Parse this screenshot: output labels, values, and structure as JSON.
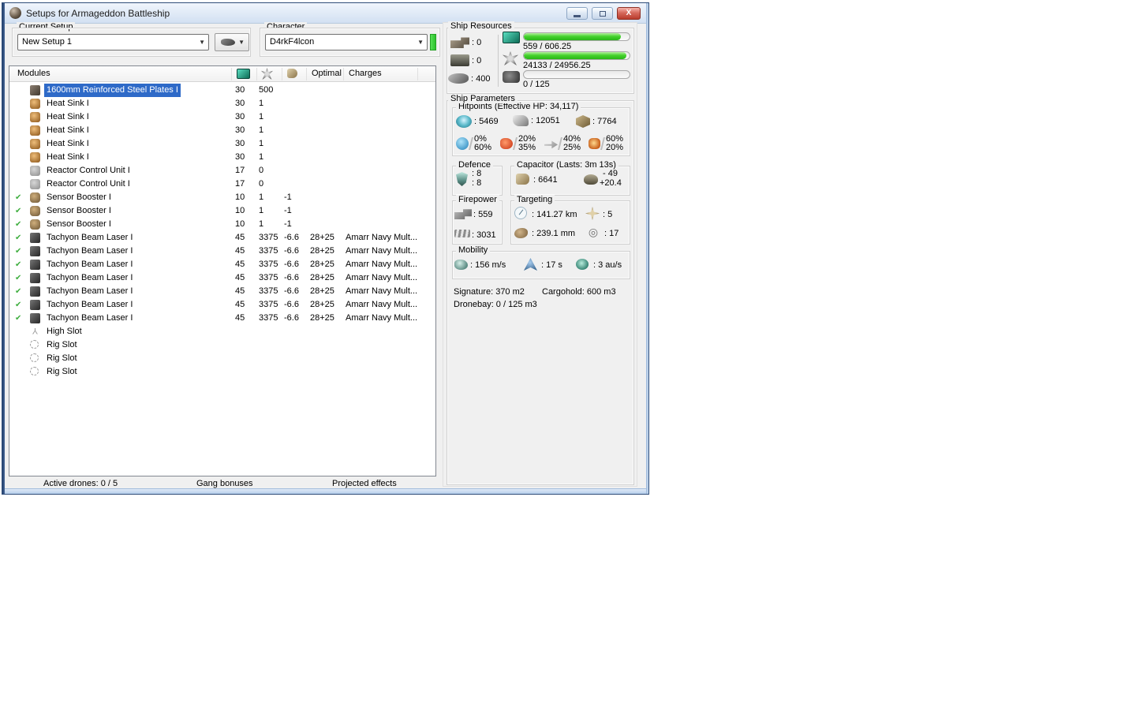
{
  "window": {
    "title": "Setups for Armageddon Battleship"
  },
  "toolbar": {
    "current_setup": {
      "label": "Current Setup",
      "value": "New Setup 1"
    },
    "character": {
      "label": "Character",
      "value": "D4rkF4lcon"
    }
  },
  "modules": {
    "header": {
      "title": "Modules",
      "optimal": "Optimal",
      "charges": "Charges"
    },
    "rows": [
      {
        "icon": "armor-plate",
        "name": "1600mm Reinforced Steel Plates I",
        "cpu": "30",
        "pg": "500",
        "cap": "",
        "optimal": "",
        "charges": "",
        "active": false,
        "selected": true
      },
      {
        "icon": "heat-sink",
        "name": "Heat Sink I",
        "cpu": "30",
        "pg": "1",
        "cap": "",
        "optimal": "",
        "charges": "",
        "active": false,
        "selected": false
      },
      {
        "icon": "heat-sink",
        "name": "Heat Sink I",
        "cpu": "30",
        "pg": "1",
        "cap": "",
        "optimal": "",
        "charges": "",
        "active": false,
        "selected": false
      },
      {
        "icon": "heat-sink",
        "name": "Heat Sink I",
        "cpu": "30",
        "pg": "1",
        "cap": "",
        "optimal": "",
        "charges": "",
        "active": false,
        "selected": false
      },
      {
        "icon": "heat-sink",
        "name": "Heat Sink I",
        "cpu": "30",
        "pg": "1",
        "cap": "",
        "optimal": "",
        "charges": "",
        "active": false,
        "selected": false
      },
      {
        "icon": "heat-sink",
        "name": "Heat Sink I",
        "cpu": "30",
        "pg": "1",
        "cap": "",
        "optimal": "",
        "charges": "",
        "active": false,
        "selected": false
      },
      {
        "icon": "reactor-control",
        "name": "Reactor Control Unit I",
        "cpu": "17",
        "pg": "0",
        "cap": "",
        "optimal": "",
        "charges": "",
        "active": false,
        "selected": false
      },
      {
        "icon": "reactor-control",
        "name": "Reactor Control Unit I",
        "cpu": "17",
        "pg": "0",
        "cap": "",
        "optimal": "",
        "charges": "",
        "active": false,
        "selected": false
      },
      {
        "icon": "sensor-booster",
        "name": "Sensor Booster I",
        "cpu": "10",
        "pg": "1",
        "cap": "-1",
        "optimal": "",
        "charges": "",
        "active": true,
        "selected": false
      },
      {
        "icon": "sensor-booster",
        "name": "Sensor Booster I",
        "cpu": "10",
        "pg": "1",
        "cap": "-1",
        "optimal": "",
        "charges": "",
        "active": true,
        "selected": false
      },
      {
        "icon": "sensor-booster",
        "name": "Sensor Booster I",
        "cpu": "10",
        "pg": "1",
        "cap": "-1",
        "optimal": "",
        "charges": "",
        "active": true,
        "selected": false
      },
      {
        "icon": "tachyon-laser",
        "name": "Tachyon Beam Laser I",
        "cpu": "45",
        "pg": "3375",
        "cap": "-6.6",
        "optimal": "28+25",
        "charges": "Amarr Navy Mult...",
        "active": true,
        "selected": false
      },
      {
        "icon": "tachyon-laser",
        "name": "Tachyon Beam Laser I",
        "cpu": "45",
        "pg": "3375",
        "cap": "-6.6",
        "optimal": "28+25",
        "charges": "Amarr Navy Mult...",
        "active": true,
        "selected": false
      },
      {
        "icon": "tachyon-laser",
        "name": "Tachyon Beam Laser I",
        "cpu": "45",
        "pg": "3375",
        "cap": "-6.6",
        "optimal": "28+25",
        "charges": "Amarr Navy Mult...",
        "active": true,
        "selected": false
      },
      {
        "icon": "tachyon-laser",
        "name": "Tachyon Beam Laser I",
        "cpu": "45",
        "pg": "3375",
        "cap": "-6.6",
        "optimal": "28+25",
        "charges": "Amarr Navy Mult...",
        "active": true,
        "selected": false
      },
      {
        "icon": "tachyon-laser",
        "name": "Tachyon Beam Laser I",
        "cpu": "45",
        "pg": "3375",
        "cap": "-6.6",
        "optimal": "28+25",
        "charges": "Amarr Navy Mult...",
        "active": true,
        "selected": false
      },
      {
        "icon": "tachyon-laser",
        "name": "Tachyon Beam Laser I",
        "cpu": "45",
        "pg": "3375",
        "cap": "-6.6",
        "optimal": "28+25",
        "charges": "Amarr Navy Mult...",
        "active": true,
        "selected": false
      },
      {
        "icon": "tachyon-laser",
        "name": "Tachyon Beam Laser I",
        "cpu": "45",
        "pg": "3375",
        "cap": "-6.6",
        "optimal": "28+25",
        "charges": "Amarr Navy Mult...",
        "active": true,
        "selected": false
      },
      {
        "icon": "high-slot",
        "name": "High Slot",
        "cpu": "",
        "pg": "",
        "cap": "",
        "optimal": "",
        "charges": "",
        "active": false,
        "selected": false
      },
      {
        "icon": "rig-slot",
        "name": "Rig Slot",
        "cpu": "",
        "pg": "",
        "cap": "",
        "optimal": "",
        "charges": "",
        "active": false,
        "selected": false
      },
      {
        "icon": "rig-slot",
        "name": "Rig Slot",
        "cpu": "",
        "pg": "",
        "cap": "",
        "optimal": "",
        "charges": "",
        "active": false,
        "selected": false
      },
      {
        "icon": "rig-slot",
        "name": "Rig Slot",
        "cpu": "",
        "pg": "",
        "cap": "",
        "optimal": "",
        "charges": "",
        "active": false,
        "selected": false
      }
    ]
  },
  "ship_resources": {
    "label": "Ship Resources",
    "turrets": ": 0",
    "launchers": ": 0",
    "calibration": ": 400",
    "cpu": {
      "text": "559 / 606.25",
      "percent": 92
    },
    "powergrid": {
      "text": "24133 / 24956.25",
      "percent": 97
    },
    "drones": {
      "text": "0 / 125",
      "percent": 0
    }
  },
  "ship_parameters": {
    "label": "Ship Parameters",
    "hitpoints": {
      "label": "Hitpoints (Effective HP: 34,117)",
      "shield": ": 5469",
      "armor": ": 12051",
      "structure": ": 7764",
      "resists": [
        {
          "type": "em",
          "top": "0%",
          "bottom": "60%"
        },
        {
          "type": "thermal",
          "top": "20%",
          "bottom": "35%"
        },
        {
          "type": "kinetic",
          "top": "40%",
          "bottom": "25%"
        },
        {
          "type": "explosive",
          "top": "60%",
          "bottom": "20%"
        }
      ]
    },
    "defence": {
      "label": "Defence",
      "line1": ": 8",
      "line2": ": 8"
    },
    "capacitor": {
      "label": "Capacitor (Lasts: 3m 13s)",
      "amount": ": 6641",
      "delta_top": "- 49",
      "delta_bottom": "+20.4"
    },
    "firepower": {
      "label": "Firepower",
      "dps": ": 559",
      "volley": ": 3031"
    },
    "targeting": {
      "label": "Targeting",
      "range": ": 141.27 km",
      "max_targets": ": 5",
      "sensor": ": 239.1 mm",
      "scan_res": ": 17"
    },
    "mobility": {
      "label": "Mobility",
      "speed": ": 156 m/s",
      "align": ": 17 s",
      "warp": ": 3 au/s"
    },
    "signature": "Signature: 370 m2",
    "cargohold": "Cargohold: 600 m3",
    "dronebay": "Dronebay: 0 / 125 m3"
  },
  "footer": {
    "active_drones": "Active drones: 0 / 5",
    "gang_bonuses": "Gang bonuses",
    "projected_effects": "Projected effects"
  }
}
